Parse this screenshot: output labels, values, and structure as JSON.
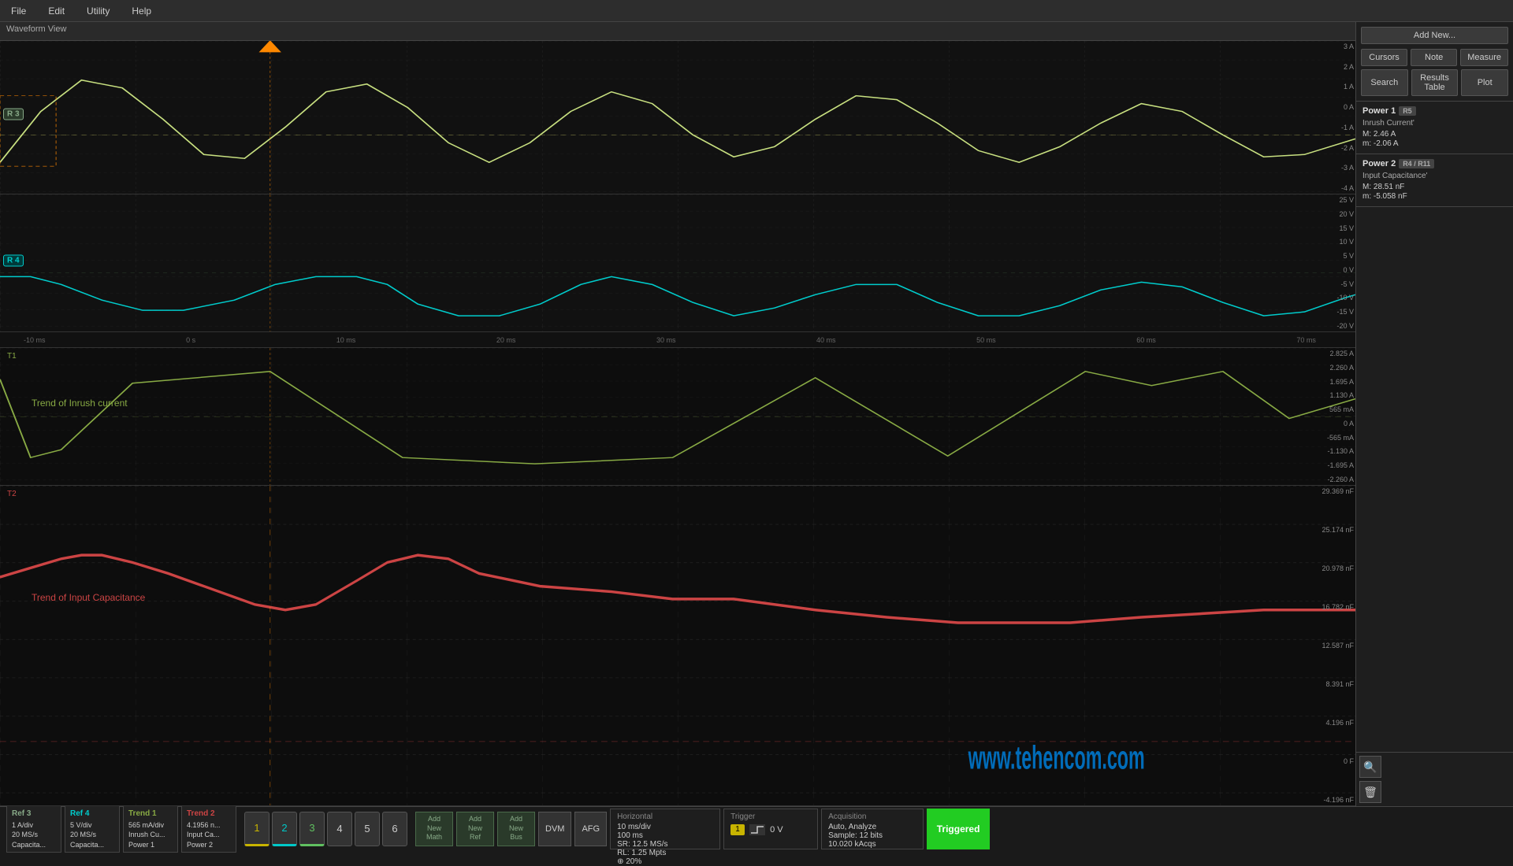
{
  "menubar": {
    "items": [
      "File",
      "Edit",
      "Utility",
      "Help"
    ]
  },
  "waveform": {
    "title": "Waveform View",
    "panels": [
      {
        "id": "panel1",
        "badge": "R 3",
        "badge_color": "#88aa88",
        "bg_color": "#111",
        "signal_color": "#c8e080",
        "y_labels": [
          "3 A",
          "2 A",
          "1 A",
          "0 A",
          "-1 A",
          "-2 A",
          "-3 A",
          "-4 A"
        ]
      },
      {
        "id": "panel2",
        "badge": "R 4",
        "badge_color": "#00cccc",
        "bg_color": "#111",
        "signal_color": "#00cccc",
        "y_labels": [
          "25 V",
          "20 V",
          "15 V",
          "10 V",
          "5 V",
          "0 V",
          "-5 V",
          "-10 V",
          "-15 V",
          "-20 V"
        ]
      },
      {
        "id": "panel3",
        "badge": "T1",
        "badge_color": "#88aa44",
        "bg_color": "#0d0d0d",
        "signal_color": "#88aa44",
        "label": "Trend of Inrush current",
        "y_labels": [
          "2.825 A",
          "2.260 A",
          "1.695 A",
          "1.130 A",
          "565 mA",
          "0 A",
          "-565 mA",
          "-1.130 A",
          "-1.695 A",
          "-2.260 A"
        ]
      },
      {
        "id": "panel4",
        "badge": "T2",
        "badge_color": "#cc4444",
        "bg_color": "#0d0d0d",
        "signal_color": "#cc4444",
        "label": "Trend of Input Capacitance",
        "y_labels": [
          "29.369 nF",
          "25.174 nF",
          "20.978 nF",
          "16.782 nF",
          "12.587 nF",
          "8.391 nF",
          "4.196 nF",
          "0 F",
          "-4.196 nF"
        ]
      }
    ],
    "time_labels": [
      "-10 ms",
      "0 s",
      "10 ms",
      "20 ms",
      "30 ms",
      "40 ms",
      "50 ms",
      "60 ms",
      "70 ms"
    ]
  },
  "right_panel": {
    "buttons": {
      "add_new": "Add New...",
      "cursors": "Cursors",
      "note": "Note",
      "measure": "Measure",
      "search": "Search",
      "results_table": "Results Table",
      "plot": "Plot"
    },
    "power1": {
      "title": "Power 1",
      "badge": "R5",
      "badge_color": "#555",
      "name": "Inrush Current'",
      "max_label": "M:",
      "max_value": "2.46 A",
      "min_label": "m:",
      "min_value": "-2.06 A"
    },
    "power2": {
      "title": "Power 2",
      "badge": "R4 / R11",
      "badge_color": "#444",
      "name": "Input Capacitance'",
      "max_label": "M:",
      "max_value": "28.51 nF",
      "min_label": "m:",
      "min_value": "-5.058 nF"
    }
  },
  "bottom": {
    "ch_tiles": [
      {
        "id": "ref3",
        "label": "Ref 3",
        "color": "#88aa88",
        "line1": "1 A/div",
        "line2": "20 MS/s",
        "line3": "Capacita..."
      },
      {
        "id": "ref4",
        "label": "Ref 4",
        "color": "#00cccc",
        "line1": "5 V/div",
        "line2": "20 MS/s",
        "line3": "Capacita..."
      },
      {
        "id": "trend1",
        "label": "Trend 1",
        "color": "#88aa44",
        "line1": "565 mA/div",
        "line2": "Inrush Cu...",
        "line3": "Power 1"
      },
      {
        "id": "trend2",
        "label": "Trend 2",
        "color": "#cc4444",
        "line1": "4.1956 n...",
        "line2": "Input Ca...",
        "line3": "Power 2"
      }
    ],
    "ch_nums": [
      {
        "num": "1",
        "color": "#c8b400"
      },
      {
        "num": "2",
        "color": "#00c8c8"
      },
      {
        "num": "3",
        "color": "#60c060"
      },
      {
        "num": "4",
        "color": "#555"
      },
      {
        "num": "5",
        "color": "#555"
      },
      {
        "num": "6",
        "color": "#555"
      }
    ],
    "add_buttons": [
      {
        "label": "Add New Math"
      },
      {
        "label": "Add New Ref"
      },
      {
        "label": "Add New Bus"
      }
    ],
    "dvm_label": "DVM",
    "afg_label": "AFG",
    "horizontal": {
      "title": "Horizontal",
      "time_div": "10 ms/div",
      "sample_rate": "SR: 12.5 MS/s",
      "rl": "RL: 1.25 Mpts",
      "zoom": "⊕ 20%",
      "delay": "100 ms"
    },
    "trigger": {
      "title": "Trigger",
      "channel": "1",
      "level": "0 V"
    },
    "acquisition": {
      "title": "Acquisition",
      "mode": "Auto,",
      "analyze": "Analyze",
      "sample": "Sample: 12 bits",
      "acqs": "10.020 kAcqs"
    },
    "triggered_label": "Triggered"
  },
  "website": "www.tehencom.com"
}
